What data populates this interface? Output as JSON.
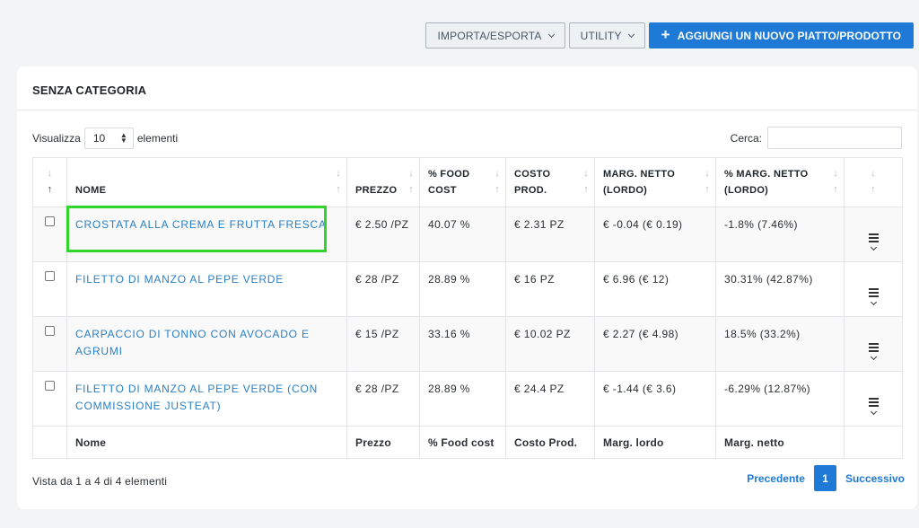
{
  "toolbar": {
    "import_export_label": "IMPORTA/ESPORTA",
    "utility_label": "UTILITY",
    "add_label": "AGGIUNGI UN NUOVO PIATTO/PRODOTTO"
  },
  "card": {
    "title": "SENZA CATEGORIA"
  },
  "length_control": {
    "prefix": "Visualizza",
    "value": "10",
    "suffix": "elementi"
  },
  "search": {
    "label": "Cerca:",
    "value": ""
  },
  "table": {
    "headers": [
      "NOME",
      "PREZZO",
      "% FOOD COST",
      "COSTO PROD.",
      "MARG. NETTO (LORDO)",
      "% MARG. NETTO (LORDO)"
    ],
    "rows": [
      {
        "name": "CROSTATA ALLA CREMA E FRUTTA FRESCA",
        "price": "€ 2.50 /PZ",
        "food_cost": "40.07 %",
        "cost": "€ 2.31 PZ",
        "margin": "€ -0.04 (€ 0.19)",
        "margin_pct": "-1.8% (7.46%)"
      },
      {
        "name": "FILETTO DI MANZO AL PEPE VERDE",
        "price": "€ 28 /PZ",
        "food_cost": "28.89 %",
        "cost": "€ 16 PZ",
        "margin": "€ 6.96 (€ 12)",
        "margin_pct": "30.31% (42.87%)"
      },
      {
        "name": "CARPACCIO DI TONNO CON AVOCADO E AGRUMI",
        "price": "€ 15 /PZ",
        "food_cost": "33.16 %",
        "cost": "€ 10.02 PZ",
        "margin": "€ 2.27 (€ 4.98)",
        "margin_pct": "18.5% (33.2%)"
      },
      {
        "name": "FILETTO DI MANZO AL PEPE VERDE (CON COMMISSIONE JUSTEAT)",
        "price": "€ 28 /PZ",
        "food_cost": "28.89 %",
        "cost": "€ 24.4 PZ",
        "margin": "€ -1.44 (€ 3.6)",
        "margin_pct": "-6.29% (12.87%)"
      }
    ],
    "footer": [
      "Nome",
      "Prezzo",
      "% Food cost",
      "Costo Prod.",
      "Marg. lordo",
      "Marg. netto"
    ]
  },
  "info_text": "Vista da 1 a 4 di 4 elementi",
  "pagination": {
    "prev": "Precedente",
    "current": "1",
    "next": "Successivo"
  }
}
